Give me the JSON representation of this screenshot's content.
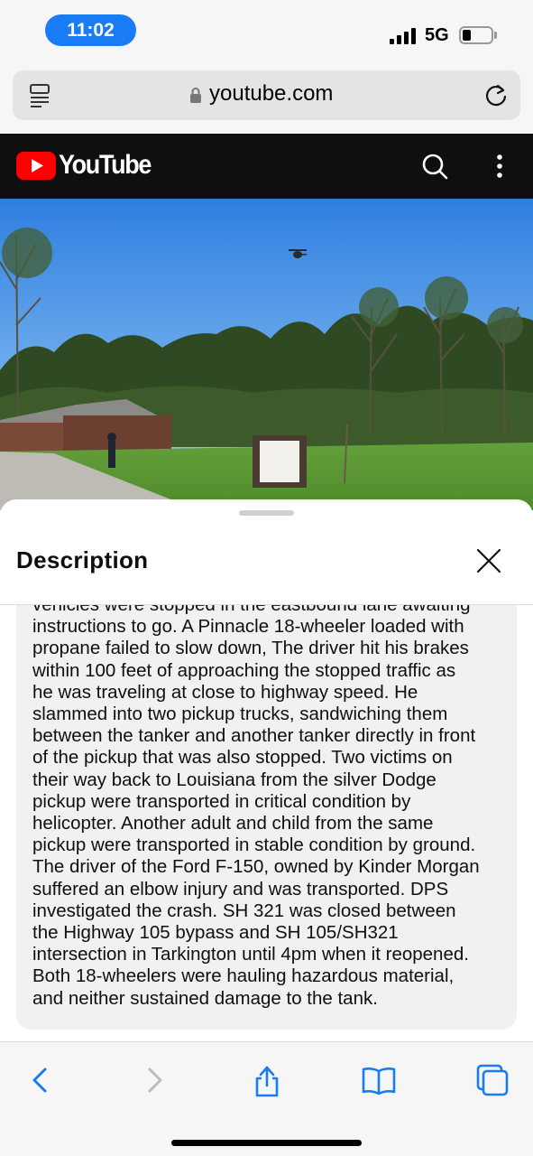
{
  "status_bar": {
    "time": "11:02",
    "network": "5G",
    "signal_bars": 4,
    "battery_level": 0.3,
    "time_pill_color": "#1a7cf5"
  },
  "browser": {
    "url": "youtube.com",
    "icons": [
      "reader-icon",
      "lock-icon",
      "reload-icon"
    ]
  },
  "youtube": {
    "wordmark": "YouTube",
    "brand_color": "#ff0000",
    "icons": [
      "youtube-logo-icon",
      "search-icon",
      "more-vertical-icon"
    ]
  },
  "sheet": {
    "title": "Description",
    "close_icon": "close-icon",
    "lines": [
      "vehicles were stopped in the eastbound lane awaiting",
      "instructions to go. A Pinnacle 18-wheeler loaded with",
      "propane failed to slow down, The driver hit his brakes",
      "within 100 feet of approaching the stopped traffic as",
      "he was traveling at close to highway speed. He",
      "slammed into two pickup trucks, sandwiching them",
      "between the tanker and another tanker directly in front",
      "of the pickup that was also stopped. Two victims on",
      "their way back to Louisiana from the silver Dodge",
      "pickup were transported in critical condition by",
      "helicopter. Another adult and child from the same",
      "pickup were transported in stable condition by ground.",
      "The driver of the Ford F-150, owned by Kinder Morgan",
      "suffered an elbow injury and was transported.  DPS",
      "investigated the crash. SH 321 was closed between",
      "the Highway 105 bypass and SH 105/SH321",
      "intersection in Tarkington until 4pm when it reopened.",
      "Both 18-wheelers were hauling hazardous material,",
      "and neither sustained damage to the tank."
    ]
  },
  "toolbar": {
    "items": [
      "back-icon",
      "forward-icon",
      "share-icon",
      "bookmarks-icon",
      "tabs-icon"
    ],
    "accent_color": "#1a7cf5",
    "disabled_color": "#bdbdbd"
  }
}
